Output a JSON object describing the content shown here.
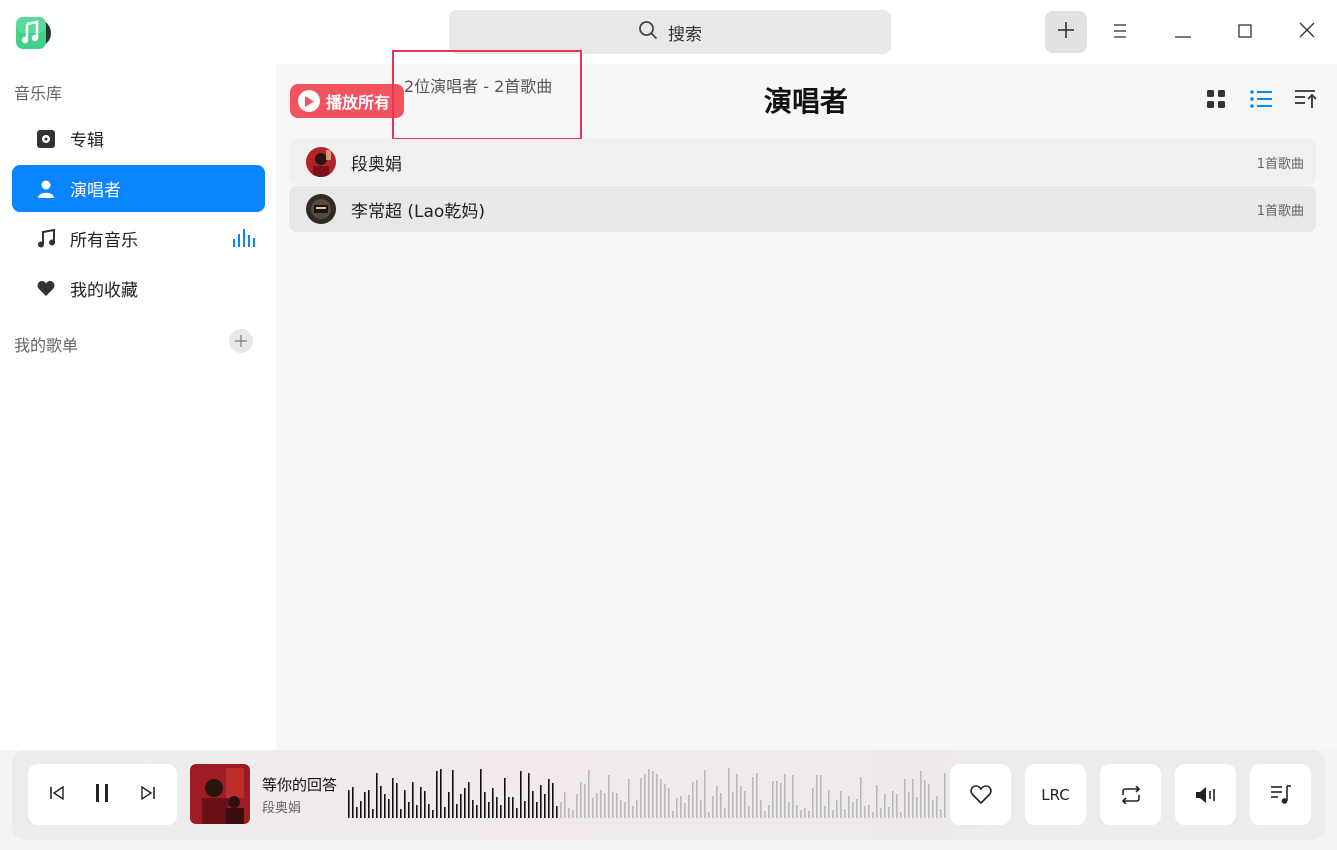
{
  "titlebar": {
    "search_label": "搜索"
  },
  "sidebar": {
    "library_label": "音乐库",
    "items": [
      {
        "label": "专辑",
        "icon": "album-icon"
      },
      {
        "label": "演唱者",
        "icon": "artist-icon",
        "active": true
      },
      {
        "label": "所有音乐",
        "icon": "music-note-icon"
      },
      {
        "label": "我的收藏",
        "icon": "heart-icon"
      }
    ],
    "playlists_label": "我的歌单"
  },
  "main": {
    "play_all_label": "播放所有",
    "summary": "2位演唱者 - 2首歌曲",
    "title": "演唱者",
    "artists": [
      {
        "name": "段奥娟",
        "count": "1首歌曲"
      },
      {
        "name": "李常超 (Lao乾妈)",
        "count": "1首歌曲"
      }
    ]
  },
  "player": {
    "song_title": "等你的回答",
    "song_artist": "段奥娟",
    "lrc_label": "LRC",
    "progress": 0.35
  },
  "colors": {
    "accent": "#0a84ff",
    "play_all": "#f1535f",
    "highlight": "#e8335a"
  }
}
